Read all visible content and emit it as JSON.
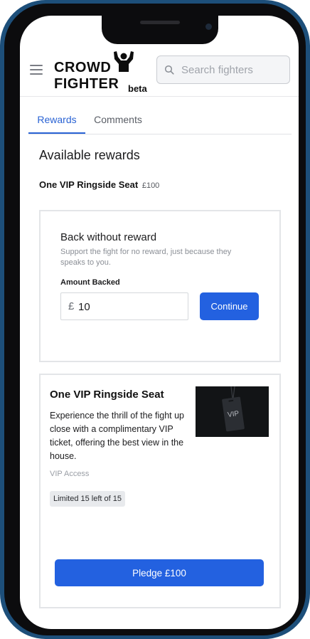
{
  "header": {
    "logo_line1": "CROWD",
    "logo_line2": "FIGHTER",
    "logo_beta": "beta",
    "search_placeholder": "Search fighters"
  },
  "tabs": [
    {
      "label": "Rewards",
      "active": true
    },
    {
      "label": "Comments",
      "active": false
    }
  ],
  "main": {
    "section_title": "Available rewards",
    "featured_title": "One VIP Ringside Seat",
    "featured_price": "£100"
  },
  "back_without_reward": {
    "title": "Back without reward",
    "description": "Support the fight for no reward, just because they speaks to you.",
    "amount_label": "Amount Backed",
    "currency_symbol": "£",
    "amount_value": "10",
    "continue_label": "Continue"
  },
  "reward": {
    "title": "One VIP Ringside Seat",
    "description": "Experience the thrill of the fight up close with a complimentary VIP ticket, offering the best view in the house.",
    "tag": "VIP Access",
    "limit_badge": "Limited 15 left of 15",
    "image_text": "VIP",
    "pledge_label": "Pledge £100"
  },
  "colors": {
    "accent": "#2361e0",
    "tab_active": "#2a63d4",
    "phone_frame": "#1d4f7a"
  },
  "icons": {
    "menu": "hamburger-icon",
    "search": "search-icon",
    "logo_figure": "fighter-silhouette-icon"
  }
}
